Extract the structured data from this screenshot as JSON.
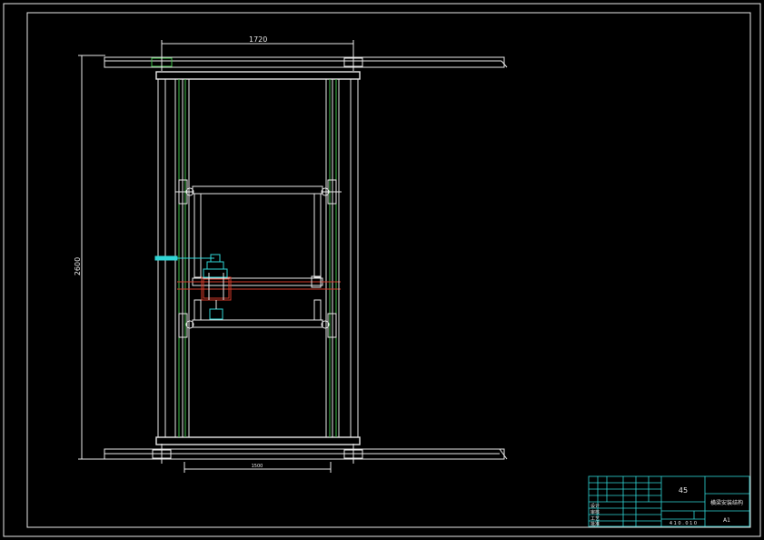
{
  "drawing": {
    "dim_width": "1720",
    "dim_height": "2600",
    "dim_bottom": "1500"
  },
  "title_block": {
    "material": "45",
    "drawing_name": "横梁安装结构",
    "scale": "A1",
    "row_design": "设计",
    "row_check": "审核",
    "row_process": "工艺",
    "row_approve": "批准",
    "code": "4 1 0 . 0 1 0"
  },
  "colors": {
    "background": "#000000",
    "lines": "#e8e8e8",
    "green": "#3fbf4a",
    "red": "#d23a2a",
    "cyan": "#2fd6d6"
  }
}
